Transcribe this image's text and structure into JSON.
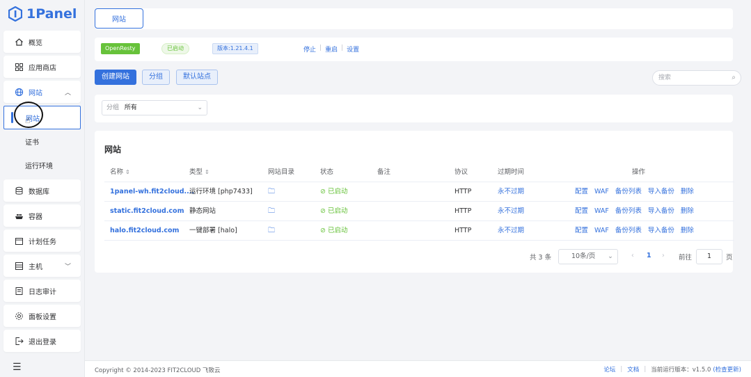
{
  "brand": {
    "name": "1Panel",
    "color": "#3471dd"
  },
  "sidebar": {
    "items": [
      {
        "icon": "home-icon",
        "label": "概览"
      },
      {
        "icon": "app-store-icon",
        "label": "应用商店"
      },
      {
        "icon": "globe-icon",
        "label": "网站",
        "expanded": true
      },
      {
        "icon": "database-icon",
        "label": "数据库"
      },
      {
        "icon": "container-icon",
        "label": "容器"
      },
      {
        "icon": "calendar-icon",
        "label": "计划任务"
      },
      {
        "icon": "host-icon",
        "label": "主机"
      },
      {
        "icon": "log-icon",
        "label": "日志审计"
      },
      {
        "icon": "gear-icon",
        "label": "面板设置"
      },
      {
        "icon": "logout-icon",
        "label": "退出登录"
      }
    ],
    "sub_items": [
      "网站",
      "证书",
      "运行环境"
    ]
  },
  "tabs": [
    {
      "label": "网站"
    }
  ],
  "openresty": {
    "name": "OpenResty",
    "status": "已启动",
    "version": "版本:1.21.4.1",
    "actions": [
      "停止",
      "重启",
      "设置"
    ]
  },
  "toolbar": {
    "create": "创建网站",
    "group": "分组",
    "default_site": "默认站点",
    "search_placeholder": "搜索"
  },
  "filter": {
    "label": "分组",
    "value": "所有"
  },
  "table": {
    "title": "网站",
    "headers": {
      "name": "名称",
      "type": "类型",
      "dir": "网站目录",
      "status": "状态",
      "remark": "备注",
      "protocol": "协议",
      "expire": "过期时间",
      "ops": "操作"
    },
    "rows": [
      {
        "name": "1panel-wh.fit2cloud....",
        "type": "运行环境 [php7433]",
        "status": "已启动",
        "protocol": "HTTP",
        "expire": "永不过期"
      },
      {
        "name": "static.fit2cloud.com",
        "type": "静态网站",
        "status": "已启动",
        "protocol": "HTTP",
        "expire": "永不过期"
      },
      {
        "name": "halo.fit2cloud.com",
        "type": "一键部署 [halo]",
        "status": "已启动",
        "protocol": "HTTP",
        "expire": "永不过期"
      }
    ],
    "row_ops": [
      "配置",
      "WAF",
      "备份列表",
      "导入备份",
      "删除"
    ]
  },
  "pager": {
    "total": "共 3 条",
    "page_size": "10条/页",
    "current": "1",
    "goto_label": "前往",
    "goto_value": "1",
    "unit": "页"
  },
  "footer": {
    "copyright": "Copyright © 2014-2023 FIT2CLOUD 飞致云",
    "forum": "论坛",
    "docs": "文档",
    "version_label": "当前运行版本：v1.5.0",
    "check_update": "(检查更新)"
  }
}
